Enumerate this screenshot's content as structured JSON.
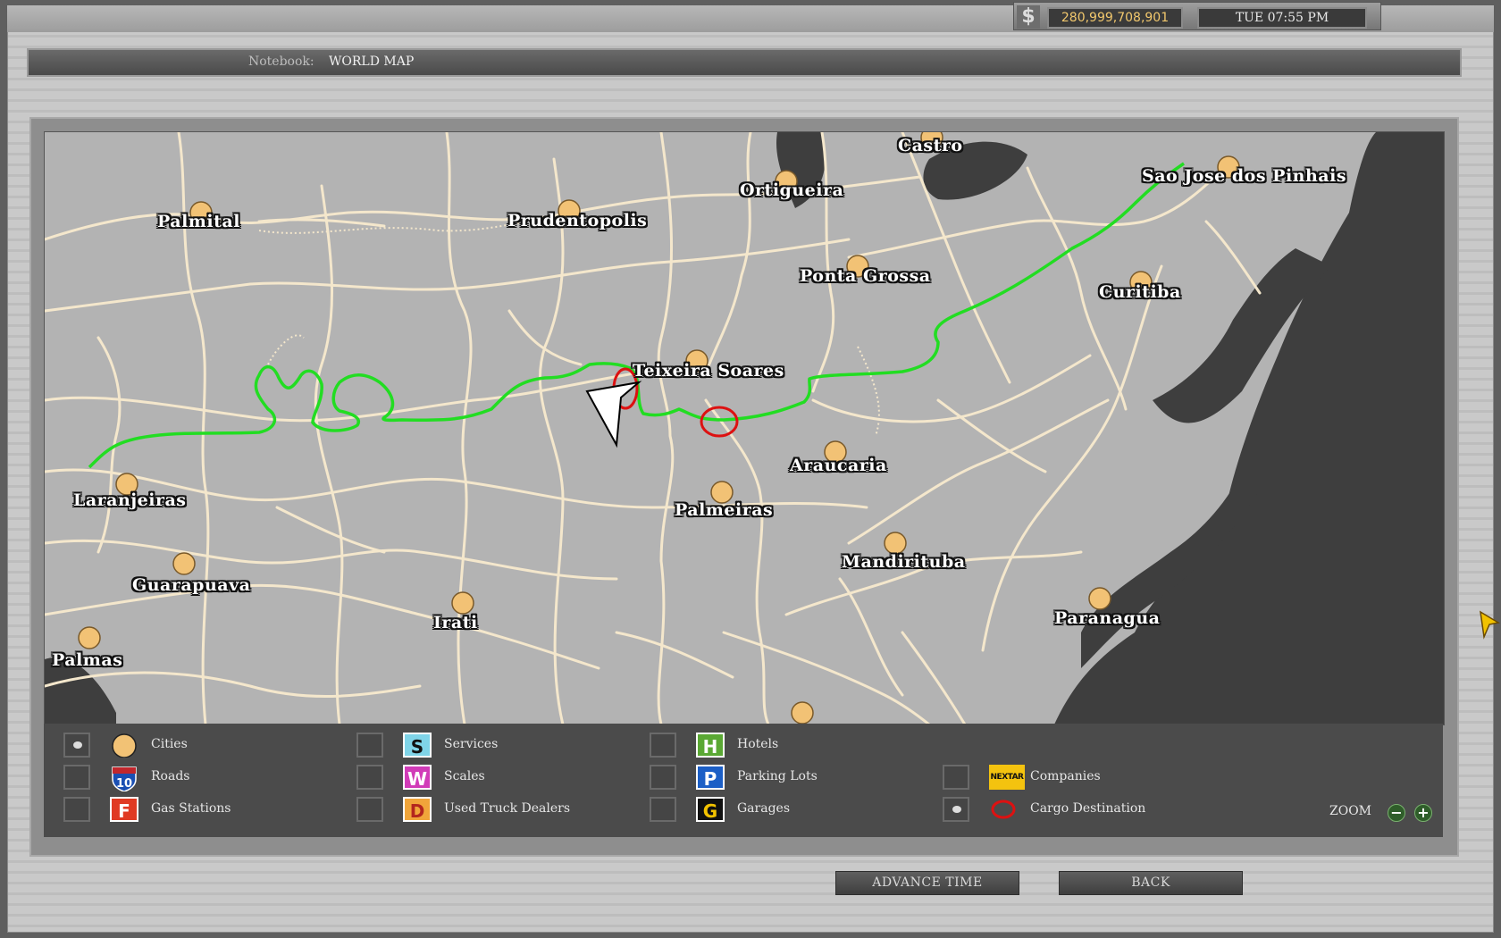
{
  "hud": {
    "currency_icon": "dollar-icon",
    "money": "280,999,708,901",
    "clock": "TUE 07:55 PM"
  },
  "notebook": {
    "label": "Notebook:",
    "title": "WORLD MAP"
  },
  "map": {
    "cities": [
      {
        "name": "Castro"
      },
      {
        "name": "Sao Jose dos Pinhais"
      },
      {
        "name": "Ortigueira"
      },
      {
        "name": "Palmital"
      },
      {
        "name": "Prudentopolis"
      },
      {
        "name": "Ponta Grossa"
      },
      {
        "name": "Curitiba"
      },
      {
        "name": "Teixeira Soares"
      },
      {
        "name": "Araucaria"
      },
      {
        "name": "Laranjeiras"
      },
      {
        "name": "Palmeiras"
      },
      {
        "name": "Mandirituba"
      },
      {
        "name": "Guarapuava"
      },
      {
        "name": "Paranagua"
      },
      {
        "name": "Irati"
      },
      {
        "name": "Palmas"
      }
    ],
    "route_color": "#22dd22",
    "cargo_marker_color": "#dd1111",
    "road_color": "#f4e7cc",
    "water_color": "#3e3e3e"
  },
  "legend": {
    "items": [
      {
        "label": "Cities",
        "icon": "city-icon",
        "checked": true
      },
      {
        "label": "Roads",
        "icon": "interstate-shield-icon",
        "badge": "10",
        "checked": false
      },
      {
        "label": "Gas Stations",
        "icon": "gas-station-icon",
        "badge": "F",
        "checked": false
      },
      {
        "label": "Services",
        "icon": "services-icon",
        "badge": "S",
        "checked": false
      },
      {
        "label": "Scales",
        "icon": "scales-icon",
        "badge": "W",
        "checked": false
      },
      {
        "label": "Used Truck Dealers",
        "icon": "used-truck-dealer-icon",
        "badge": "D",
        "checked": false
      },
      {
        "label": "Hotels",
        "icon": "hotel-icon",
        "badge": "H",
        "checked": false
      },
      {
        "label": "Parking Lots",
        "icon": "parking-icon",
        "badge": "P",
        "checked": false
      },
      {
        "label": "Garages",
        "icon": "garage-icon",
        "badge": "G",
        "checked": false
      },
      {
        "label": "Companies",
        "icon": "company-logo-icon",
        "badge": "NEXTAR",
        "checked": false
      },
      {
        "label": "Cargo Destination",
        "icon": "cargo-destination-icon",
        "checked": true
      }
    ],
    "zoom_label": "ZOOM"
  },
  "buttons": {
    "advance_time": "ADVANCE TIME",
    "back": "BACK"
  }
}
